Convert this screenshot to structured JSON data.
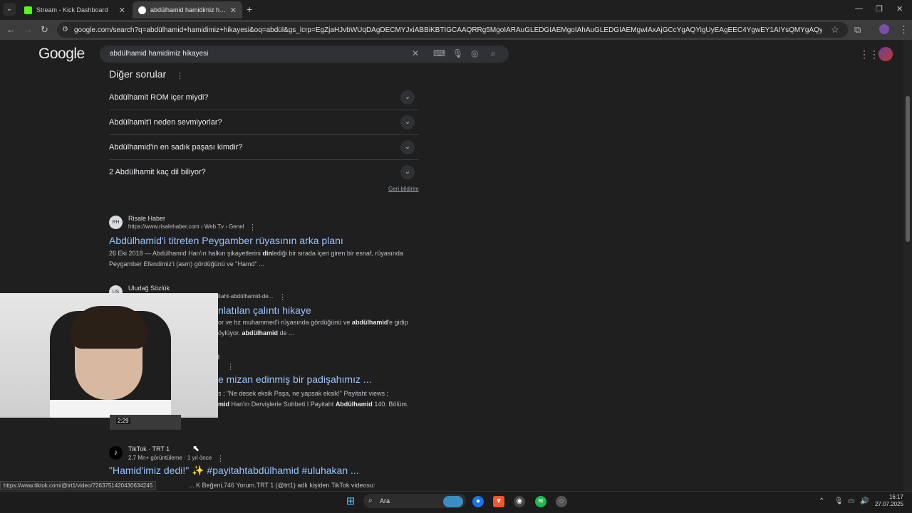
{
  "browser": {
    "tabs": [
      {
        "title": "Stream - Kick Dashboard",
        "active": false
      },
      {
        "title": "abdülhamid hamidimiz hikayesi",
        "active": true
      }
    ],
    "url": "google.com/search?q=abdülhamid+hamidimiz+hikayesi&oq=abdül&gs_lcrp=EgZjaHJvbWUqDAgDECMYJxiABBiKBTIGCAAQRRg5MgoIARAuGLEDGIAEMgoIAhAuGLEDGIAEMgwIAxAjGCcYgAQYigUyEAgEEC4YgwEY1AIYsQMYgAQyEAgFEC4YgwEY1AIYsQMY..."
  },
  "google": {
    "logo": "Google",
    "query": "abdülhamid hamidimiz hikayesi"
  },
  "paa": {
    "title": "Diğer sorular",
    "questions": [
      "Abdülhamit ROM içer miydi?",
      "Abdülhamit'i neden sevmiyorlar?",
      "Abdülhamid'in en sadık paşası kimdir?",
      "2 Abdülhamit kaç dil biliyor?"
    ],
    "feedback": "Geri bildirim"
  },
  "results": [
    {
      "site": "Risale Haber",
      "url": "https://www.risalehaber.com › Web Tv › Genel",
      "title": "Abdülhamid'i titreten Peygamber rüyasının arka planı",
      "snippet_line1_pre": "26 Eki 2018 — Abdülhamid Han'ın halkın şikayetlerini ",
      "snippet_line1_bold": "din",
      "snippet_line1_post": "lediği bir sırada içeri giren bir esnaf, rüyasında",
      "snippet_line2": "Peygamber Efendimiz'i (asm) gördüğünü ve \"Hamd\" ..."
    },
    {
      "site": "Uludağ Sözlük",
      "url": "itaht-abdülhamid-de...",
      "title": "nlatılan çalıntı hikaye",
      "snippet_line1_pre": "or ve hz muhammed'i rüyasında gördüğünü ve ",
      "snippet_line1_bold": "abdülhamid",
      "snippet_line1_post": "'e gidip",
      "snippet_line2_pre": "öylüyor. ",
      "snippet_line2_bold": "abdülhamid",
      "snippet_line2_post": " de ..."
    },
    {
      "site": "d",
      "title": "e mizan edinmiş bir padişahımız ...",
      "snippet_line1": "s ; \"Ne desek eksik Paşa, ne yapsak eksik!\" Payitaht   views ;",
      "snippet_line2_bold1": "mid",
      "snippet_line2_mid": " Han'ın Dervişlerle Sohbeti I Payitaht ",
      "snippet_line2_bold2": "Abdülhamid",
      "snippet_line2_post": " 140. Bölüm."
    },
    {
      "site": "TikTok · TRT 1",
      "meta": "2,7 Mn+ görüntüleme · 1 yıl önce",
      "title": "\"Hamid'imiz dedi!\" ✨ #payitahtabdülhamid #uluhakan ...",
      "snippet": "... K Beğeni,746 Yorum.TRT 1 (@trt1) adlı kişiden TikTok videosu:",
      "duration": "2:29"
    }
  ],
  "status_url": "https://www.tiktok.com/@trt1/video/7263751420430634245",
  "taskbar": {
    "search_label": "Ara",
    "time": "16:17",
    "date": "27.07.2025"
  }
}
